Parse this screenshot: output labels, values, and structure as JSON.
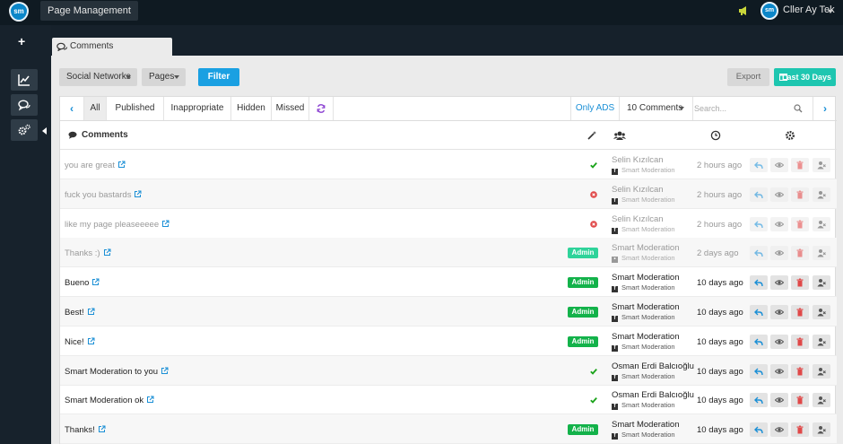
{
  "app": {
    "logo_text": "sm",
    "page_title": "Page Management",
    "user_name": "Cller Ay Tek"
  },
  "sidebar": {
    "add_label": "+",
    "items": [
      {
        "name": "analytics",
        "icon": "line-chart-icon"
      },
      {
        "name": "comments",
        "icon": "comments-icon"
      },
      {
        "name": "settings",
        "icon": "gears-icon"
      }
    ]
  },
  "tab": {
    "label": "Comments"
  },
  "filters": {
    "social_networks": "Social Networks",
    "pages": "Pages",
    "filter_button": "Filter",
    "export_button": "Export",
    "date_range_button": "Last 30 Days"
  },
  "tabbar": {
    "tabs": [
      "All",
      "Published",
      "Inappropriate",
      "Hidden",
      "Missed"
    ],
    "active_tab": "All",
    "only_ads": "Only ADS",
    "count_select": "10 Comments",
    "search_placeholder": "Search..."
  },
  "table": {
    "header_title": "Comments",
    "rows": [
      {
        "text": "you are great",
        "badge": "",
        "status": "check",
        "author": "Selin Kızılcan",
        "source": "Smart Moderation",
        "source_icon": "facebook",
        "time": "2 hours ago",
        "state": "dim"
      },
      {
        "text": "fuck you bastards",
        "badge": "",
        "status": "cross",
        "author": "Selin Kızılcan",
        "source": "Smart Moderation",
        "source_icon": "facebook",
        "time": "2 hours ago",
        "state": "dim"
      },
      {
        "text": "like my page pleaseeeee",
        "badge": "",
        "status": "cross",
        "author": "Selin Kızılcan",
        "source": "Smart Moderation",
        "source_icon": "facebook",
        "time": "2 hours ago",
        "state": "dim"
      },
      {
        "text": "Thanks :)",
        "badge": "Admin",
        "status": "",
        "author": "Smart Moderation",
        "source": "Smart Moderation",
        "source_icon": "user",
        "time": "2 days ago",
        "state": "dim"
      },
      {
        "text": "Bueno",
        "badge": "Admin",
        "status": "",
        "author": "Smart Moderation",
        "source": "Smart Moderation",
        "source_icon": "facebook",
        "time": "10 days ago",
        "state": "bright"
      },
      {
        "text": "Best!",
        "badge": "Admin",
        "status": "",
        "author": "Smart Moderation",
        "source": "Smart Moderation",
        "source_icon": "facebook",
        "time": "10 days ago",
        "state": "bright"
      },
      {
        "text": "Nice!",
        "badge": "Admin",
        "status": "",
        "author": "Smart Moderation",
        "source": "Smart Moderation",
        "source_icon": "facebook",
        "time": "10 days ago",
        "state": "bright"
      },
      {
        "text": "Smart Moderation to you",
        "badge": "",
        "status": "check",
        "author": "Osman Erdi Balcıoğlu",
        "source": "Smart Moderation",
        "source_icon": "facebook",
        "time": "10 days ago",
        "state": "bright"
      },
      {
        "text": "Smart Moderation ok",
        "badge": "",
        "status": "check",
        "author": "Osman Erdi Balcıoğlu",
        "source": "Smart Moderation",
        "source_icon": "facebook",
        "time": "10 days ago",
        "state": "bright"
      },
      {
        "text": "Thanks!",
        "badge": "Admin",
        "status": "",
        "author": "Smart Moderation",
        "source": "Smart Moderation",
        "source_icon": "facebook",
        "time": "10 days ago",
        "state": "bright"
      }
    ]
  },
  "colors": {
    "accent": "#1aa0e2",
    "teal": "#1ec6b0",
    "badge_green": "#13b24a",
    "badge_teal": "#2fd39a",
    "check": "#1aa31a",
    "cross": "#e04848",
    "delete": "#e04848",
    "sync": "#8a3fd1"
  }
}
